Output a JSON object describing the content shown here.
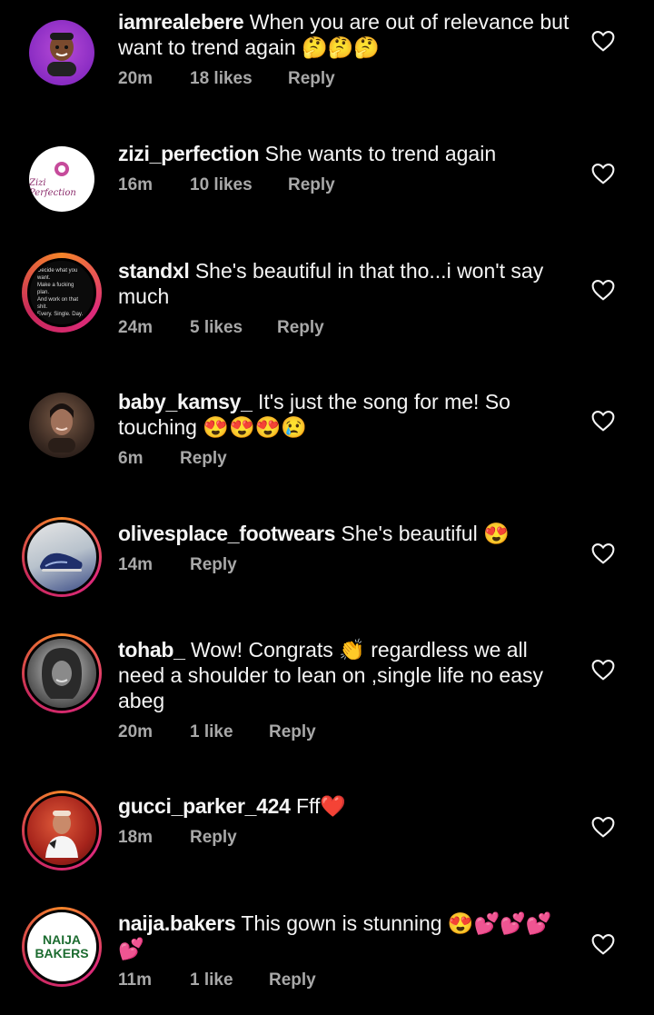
{
  "comments": [
    {
      "username": "iamrealebere",
      "text": "When you are out of relevance but want to trend again 🤔🤔🤔",
      "time": "20m",
      "likes": "18 likes",
      "reply": "Reply",
      "avatar": "bitmoji-avatar"
    },
    {
      "username": "zizi_perfection",
      "text": "She wants to trend again",
      "time": "16m",
      "likes": "10 likes",
      "reply": "Reply",
      "avatar": "zizi-perfection-logo",
      "avatar_text": "Zizi Perfection"
    },
    {
      "username": "standxl",
      "text": "She's beautiful in that tho...i won't say much",
      "time": "24m",
      "likes": "5 likes",
      "reply": "Reply",
      "avatar": "quote-avatar",
      "avatar_lines": [
        "Decide what you want.",
        "Make a fucking plan.",
        "And work on that shit.",
        "Every. Single. Day."
      ]
    },
    {
      "username": "baby_kamsy_",
      "text": "It's just the song for me! So touching 😍😍😍😢",
      "time": "6m",
      "likes": "",
      "reply": "Reply",
      "avatar": "woman-portrait"
    },
    {
      "username": "olivesplace_footwears",
      "text": "She's beautiful 😍",
      "time": "14m",
      "likes": "",
      "reply": "Reply",
      "avatar": "shoe-photo"
    },
    {
      "username": "tohab_",
      "text": "Wow! Congrats 👏 regardless we all need a shoulder to lean on ,single life no easy abeg",
      "time": "20m",
      "likes": "1 like",
      "reply": "Reply",
      "avatar": "bw-portrait"
    },
    {
      "username": "gucci_parker_424",
      "text": "Fff❤️",
      "time": "18m",
      "likes": "",
      "reply": "Reply",
      "avatar": "red-portrait"
    },
    {
      "username": "naija.bakers",
      "text": "This gown is stunning 😍💕💕💕💕",
      "time": "11m",
      "likes": "1 like",
      "reply": "Reply",
      "avatar": "naija-bakers-logo",
      "avatar_lines": [
        "NAIJA",
        "BAKERS"
      ]
    }
  ],
  "colors": {
    "background": "#000000",
    "text": "#f5f5f5",
    "meta": "#a8a8a8",
    "story_ring": "#dd2a7b"
  }
}
